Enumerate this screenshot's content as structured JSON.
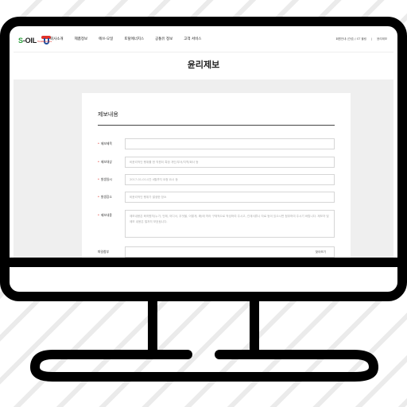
{
  "header": {
    "logo_text_s": "S",
    "logo_text_rest": "-OIL",
    "logo_sub": "TotalEnergies",
    "nav": [
      "회사소개",
      "제품정보",
      "에쓰-오일",
      "토탈에너지스",
      "공통유 정보",
      "고객 서비스"
    ],
    "util": [
      "회원안내 (관성) / ST 몰링",
      "|",
      "윤리제보"
    ]
  },
  "page": {
    "title": "윤리제보"
  },
  "form": {
    "section_title": "제보내용",
    "required_mark": "*",
    "fields": [
      {
        "label": "제보제목",
        "required": true,
        "placeholder": ""
      },
      {
        "label": "제보대상",
        "required": true,
        "placeholder": "비윤리적인 행위를 한 직원이 특정 개인/부서/지역/회사 등"
      },
      {
        "label": "발생일시",
        "required": true,
        "placeholder": "2017-01-01시간 4월까지 요청 요시 등"
      },
      {
        "label": "발생장소",
        "required": true,
        "placeholder": "비윤리적인 행위가 발생한 장소"
      },
      {
        "label": "제보내용",
        "required": true,
        "placeholder": "제보내용은 육하원칙(누가, 언제, 어디서, 무엇을, 어떻게, 왜)에 따라 구체적으로 작성하여 주시고, 관계서류나 자료 등이 있으시면 첨부하여 주시기 바랍니다. 제보자 및 제보 내용은 철저히 보호됩니다."
      },
      {
        "label": "파일첨부",
        "required": false,
        "placeholder": "",
        "button": "찾아보기"
      }
    ]
  }
}
